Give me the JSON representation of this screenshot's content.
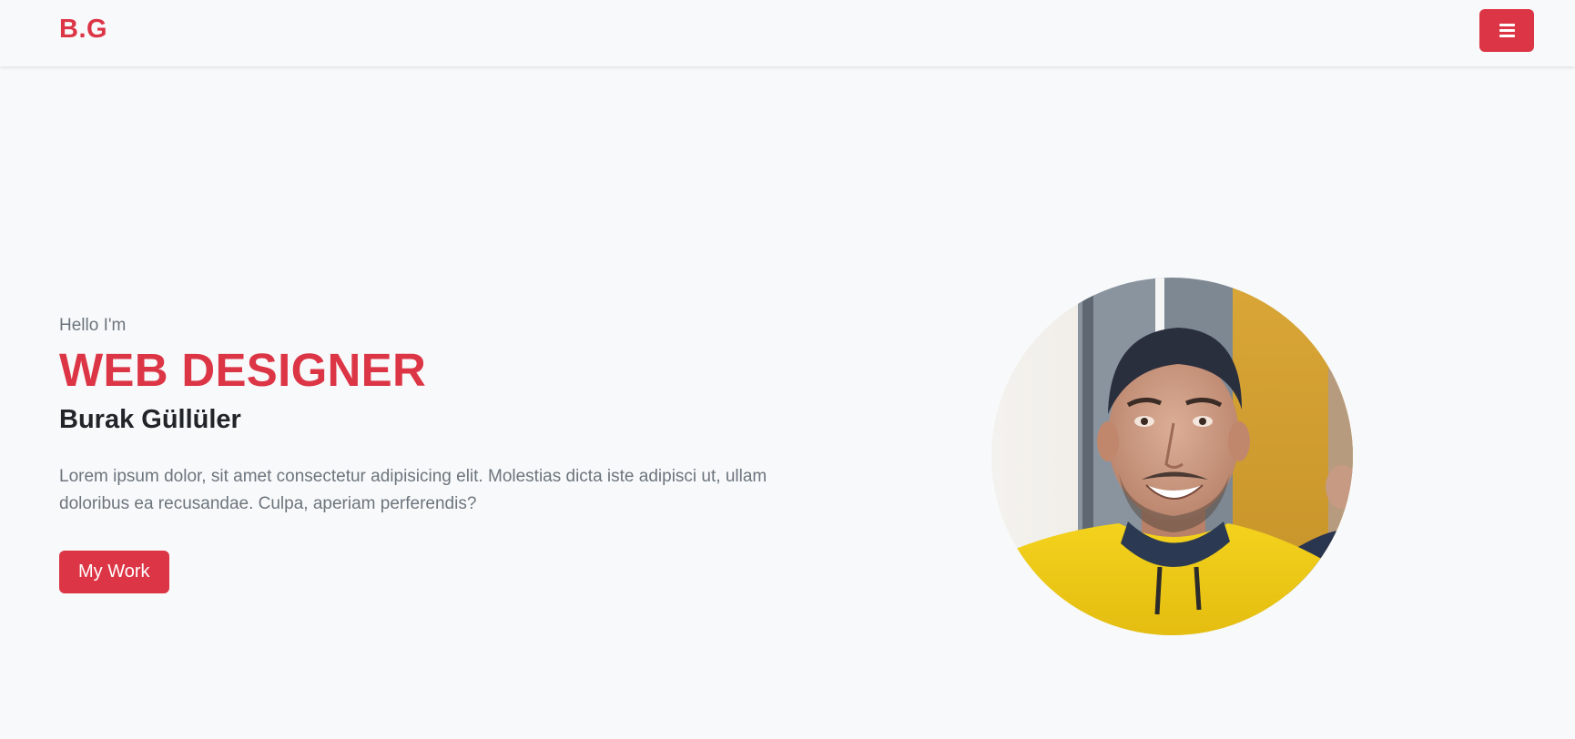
{
  "navbar": {
    "brand": "B.G",
    "menu_icon": "hamburger-menu-icon"
  },
  "hero": {
    "greeting": "Hello I'm",
    "role": "WEB DESIGNER",
    "name": "Burak Güllüler",
    "bio": "Lorem ipsum dolor, sit amet consectetur adipisicing elit. Molestias dicta iste adipisci ut, ullam doloribus ea recusandae. Culpa, aperiam perferendis?",
    "cta_label": "My Work"
  },
  "colors": {
    "accent": "#dc3545",
    "background": "#f8f9fa",
    "text_dark": "#212529",
    "text_muted": "#6c757d"
  }
}
